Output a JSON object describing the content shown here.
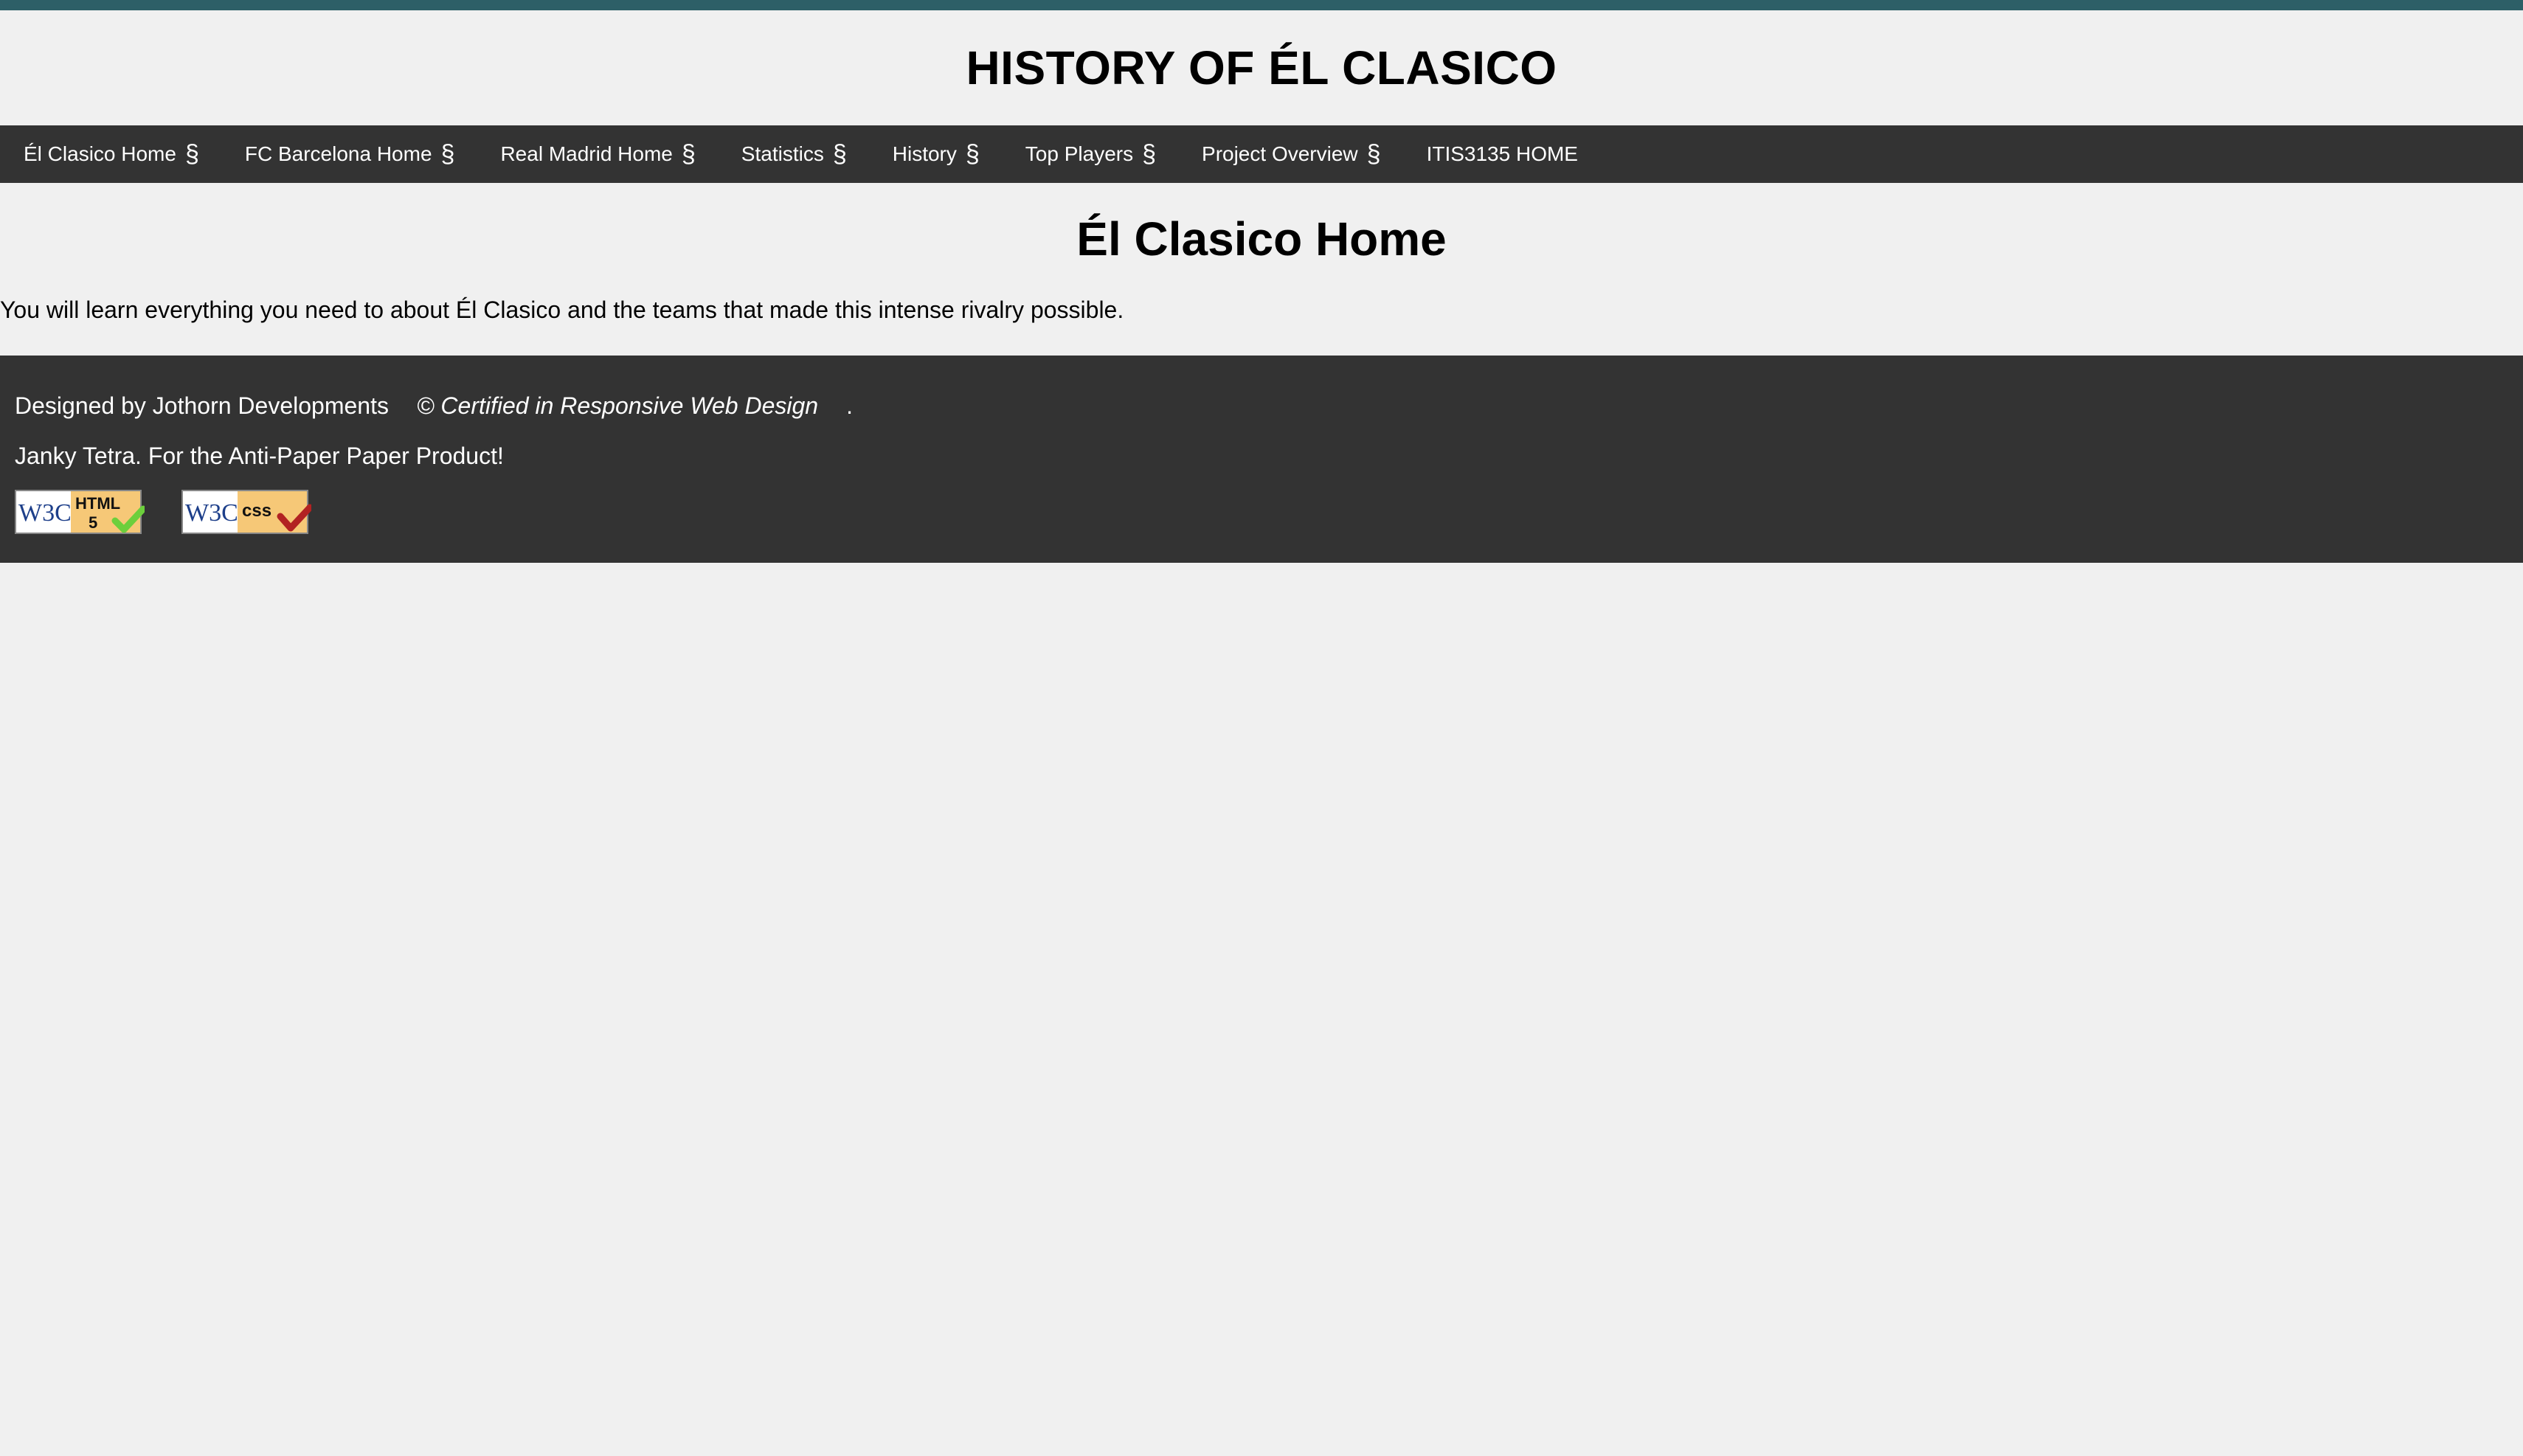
{
  "header": {
    "title": "HISTORY OF ÉL CLASICO"
  },
  "nav": {
    "items": [
      {
        "label": "Él Clasico Home",
        "sep": "§"
      },
      {
        "label": "FC Barcelona Home",
        "sep": "§"
      },
      {
        "label": "Real Madrid Home",
        "sep": "§"
      },
      {
        "label": "Statistics",
        "sep": "§"
      },
      {
        "label": "History",
        "sep": "§"
      },
      {
        "label": "Top Players",
        "sep": "§"
      },
      {
        "label": "Project Overview",
        "sep": "§"
      },
      {
        "label": "ITIS3135 HOME",
        "sep": ""
      }
    ]
  },
  "main": {
    "heading": "Él Clasico Home",
    "intro": "You will learn everything you need to about Él Clasico and the teams that made this intense rivalry possible."
  },
  "footer": {
    "designer": "Designed by Jothorn Developments",
    "certification": "© Certified in Responsive Web Design",
    "period": ".",
    "tagline": "Janky Tetra. For the Anti-Paper Paper Product!",
    "badges": [
      {
        "w3c": "W3C",
        "text_line1": "HTML",
        "text_line2": "5",
        "icon": "w3c-html5-validation-icon",
        "check_color": "#6ccf3c"
      },
      {
        "w3c": "W3C",
        "text_line1": "css",
        "text_line2": "",
        "icon": "w3c-css-validation-icon",
        "check_color": "#b22222"
      }
    ]
  },
  "colors": {
    "stripe": "#2d5f67",
    "nav_bg": "#333333",
    "page_bg": "#f0f0f0",
    "badge_fill": "#f6c877"
  }
}
